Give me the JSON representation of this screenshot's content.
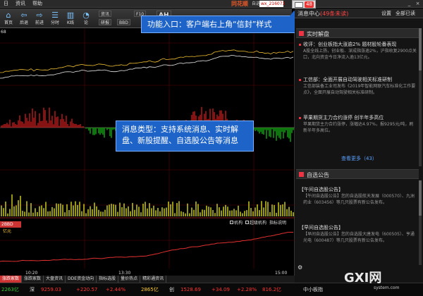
{
  "menu": {
    "items": [
      "日",
      "资讯",
      "帮助"
    ],
    "brand": "同花顺",
    "window_title": "自选股",
    "code_value": "wx_216073"
  },
  "message_badge": {
    "count": "48"
  },
  "toolbar": {
    "buttons": [
      {
        "glyph": "⌂",
        "label": "首页"
      },
      {
        "glyph": "⇦",
        "label": "后退"
      },
      {
        "glyph": "⇨",
        "label": "前进"
      },
      {
        "glyph": "☰",
        "label": "分时"
      },
      {
        "glyph": "▥",
        "label": "K线"
      },
      {
        "glyph": "◔",
        "label": "论"
      }
    ],
    "small_buttons": [
      "资讯",
      "研报",
      "BBD",
      "AH",
      "F10"
    ]
  },
  "chart": {
    "top_label": "68",
    "time_labels": [
      "10:20",
      "13:30",
      "15:00"
    ],
    "bbd_tab": "2BBD",
    "flow_label": "亿元",
    "legend": [
      "机构",
      "超级机构",
      "指标说明"
    ]
  },
  "callouts": {
    "entry": "功能入口：客户端右上角“信封”样式",
    "types": "消息类型：支持系统消息、实时解盘、新股提醒、自选股公告等消息"
  },
  "bottom_tabs": [
    "涨跌家数",
    "涨跌家数",
    "大盘资讯",
    "DDE资金动向",
    "指标选股",
    "量价热点",
    "精彩通资讯"
  ],
  "ticker": [
    {
      "name": "2263亿",
      "value": "",
      "change": "",
      "cls": "dn"
    },
    {
      "name": "深",
      "value": "9259.03",
      "change": "+220.57",
      "cls": "up"
    },
    {
      "name": "",
      "value": "+2.44%",
      "change": "",
      "cls": "up"
    },
    {
      "name": "2865亿",
      "value": "",
      "change": "",
      "cls": "yl"
    },
    {
      "name": "创",
      "value": "1528.69",
      "change": "+34.09",
      "cls": "up"
    },
    {
      "name": "",
      "value": "+2.28%",
      "change": "816.2亿",
      "cls": "up"
    }
  ],
  "ticker_right": "中小板指",
  "panel": {
    "title": "消息中心",
    "unread": "(49条未读)",
    "set_label": "设置",
    "mark_label": "全部已读",
    "sections": [
      {
        "title": "实时解盘",
        "items": [
          {
            "title": "收评：创业板指大涨逾2%  题材股轮番表现",
            "body": "A股全线上扬，创业板、深成指涨逾2%，沪指收复2900点关口，北向资金今日净流入逾13亿元。"
          },
          {
            "title": "工信部：全面开展自动驾驶相关标准研制",
            "body": "工信部装备工业司发布《2019年智能网联汽车标准化工作要点》，全面开展自动驾驶相关标准研制。"
          },
          {
            "title": "苹果期货主力合约涨停  创半年多高位",
            "body": "苹果期货主力合约涨停，涨幅达4.97%，报9295元/吨，刷新半年多高位。"
          }
        ],
        "more": "查看更多（43）"
      },
      {
        "title": "自选公告",
        "items": [
          {
            "title": "【午间自选股公告】",
            "body": "【午间自选股公告】您的自选股航天发展（000570）、九洲药业（603456）等几只股票有新公告发布。"
          },
          {
            "title": "【早间自选股公告】",
            "body": "【早间自选股公告】您的自选股大唐发电（600505）、亨通光电（600487）等几只股票有新公告发布。"
          }
        ]
      }
    ]
  },
  "watermark": {
    "main": "GXI网",
    "sub": "system.com"
  },
  "colors": {
    "up": "#ff3333",
    "down": "#33cc33",
    "accent": "#1e64c8",
    "badge": "#ee3333"
  }
}
